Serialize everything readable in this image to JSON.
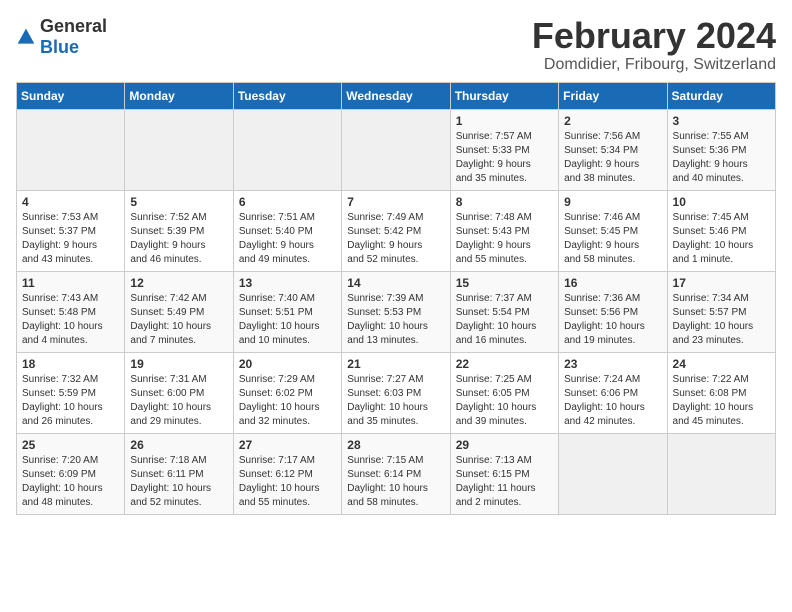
{
  "logo": {
    "general": "General",
    "blue": "Blue"
  },
  "title": "February 2024",
  "subtitle": "Domdidier, Fribourg, Switzerland",
  "weekdays": [
    "Sunday",
    "Monday",
    "Tuesday",
    "Wednesday",
    "Thursday",
    "Friday",
    "Saturday"
  ],
  "weeks": [
    [
      {
        "day": "",
        "detail": ""
      },
      {
        "day": "",
        "detail": ""
      },
      {
        "day": "",
        "detail": ""
      },
      {
        "day": "",
        "detail": ""
      },
      {
        "day": "1",
        "detail": "Sunrise: 7:57 AM\nSunset: 5:33 PM\nDaylight: 9 hours\nand 35 minutes."
      },
      {
        "day": "2",
        "detail": "Sunrise: 7:56 AM\nSunset: 5:34 PM\nDaylight: 9 hours\nand 38 minutes."
      },
      {
        "day": "3",
        "detail": "Sunrise: 7:55 AM\nSunset: 5:36 PM\nDaylight: 9 hours\nand 40 minutes."
      }
    ],
    [
      {
        "day": "4",
        "detail": "Sunrise: 7:53 AM\nSunset: 5:37 PM\nDaylight: 9 hours\nand 43 minutes."
      },
      {
        "day": "5",
        "detail": "Sunrise: 7:52 AM\nSunset: 5:39 PM\nDaylight: 9 hours\nand 46 minutes."
      },
      {
        "day": "6",
        "detail": "Sunrise: 7:51 AM\nSunset: 5:40 PM\nDaylight: 9 hours\nand 49 minutes."
      },
      {
        "day": "7",
        "detail": "Sunrise: 7:49 AM\nSunset: 5:42 PM\nDaylight: 9 hours\nand 52 minutes."
      },
      {
        "day": "8",
        "detail": "Sunrise: 7:48 AM\nSunset: 5:43 PM\nDaylight: 9 hours\nand 55 minutes."
      },
      {
        "day": "9",
        "detail": "Sunrise: 7:46 AM\nSunset: 5:45 PM\nDaylight: 9 hours\nand 58 minutes."
      },
      {
        "day": "10",
        "detail": "Sunrise: 7:45 AM\nSunset: 5:46 PM\nDaylight: 10 hours\nand 1 minute."
      }
    ],
    [
      {
        "day": "11",
        "detail": "Sunrise: 7:43 AM\nSunset: 5:48 PM\nDaylight: 10 hours\nand 4 minutes."
      },
      {
        "day": "12",
        "detail": "Sunrise: 7:42 AM\nSunset: 5:49 PM\nDaylight: 10 hours\nand 7 minutes."
      },
      {
        "day": "13",
        "detail": "Sunrise: 7:40 AM\nSunset: 5:51 PM\nDaylight: 10 hours\nand 10 minutes."
      },
      {
        "day": "14",
        "detail": "Sunrise: 7:39 AM\nSunset: 5:53 PM\nDaylight: 10 hours\nand 13 minutes."
      },
      {
        "day": "15",
        "detail": "Sunrise: 7:37 AM\nSunset: 5:54 PM\nDaylight: 10 hours\nand 16 minutes."
      },
      {
        "day": "16",
        "detail": "Sunrise: 7:36 AM\nSunset: 5:56 PM\nDaylight: 10 hours\nand 19 minutes."
      },
      {
        "day": "17",
        "detail": "Sunrise: 7:34 AM\nSunset: 5:57 PM\nDaylight: 10 hours\nand 23 minutes."
      }
    ],
    [
      {
        "day": "18",
        "detail": "Sunrise: 7:32 AM\nSunset: 5:59 PM\nDaylight: 10 hours\nand 26 minutes."
      },
      {
        "day": "19",
        "detail": "Sunrise: 7:31 AM\nSunset: 6:00 PM\nDaylight: 10 hours\nand 29 minutes."
      },
      {
        "day": "20",
        "detail": "Sunrise: 7:29 AM\nSunset: 6:02 PM\nDaylight: 10 hours\nand 32 minutes."
      },
      {
        "day": "21",
        "detail": "Sunrise: 7:27 AM\nSunset: 6:03 PM\nDaylight: 10 hours\nand 35 minutes."
      },
      {
        "day": "22",
        "detail": "Sunrise: 7:25 AM\nSunset: 6:05 PM\nDaylight: 10 hours\nand 39 minutes."
      },
      {
        "day": "23",
        "detail": "Sunrise: 7:24 AM\nSunset: 6:06 PM\nDaylight: 10 hours\nand 42 minutes."
      },
      {
        "day": "24",
        "detail": "Sunrise: 7:22 AM\nSunset: 6:08 PM\nDaylight: 10 hours\nand 45 minutes."
      }
    ],
    [
      {
        "day": "25",
        "detail": "Sunrise: 7:20 AM\nSunset: 6:09 PM\nDaylight: 10 hours\nand 48 minutes."
      },
      {
        "day": "26",
        "detail": "Sunrise: 7:18 AM\nSunset: 6:11 PM\nDaylight: 10 hours\nand 52 minutes."
      },
      {
        "day": "27",
        "detail": "Sunrise: 7:17 AM\nSunset: 6:12 PM\nDaylight: 10 hours\nand 55 minutes."
      },
      {
        "day": "28",
        "detail": "Sunrise: 7:15 AM\nSunset: 6:14 PM\nDaylight: 10 hours\nand 58 minutes."
      },
      {
        "day": "29",
        "detail": "Sunrise: 7:13 AM\nSunset: 6:15 PM\nDaylight: 11 hours\nand 2 minutes."
      },
      {
        "day": "",
        "detail": ""
      },
      {
        "day": "",
        "detail": ""
      }
    ]
  ]
}
